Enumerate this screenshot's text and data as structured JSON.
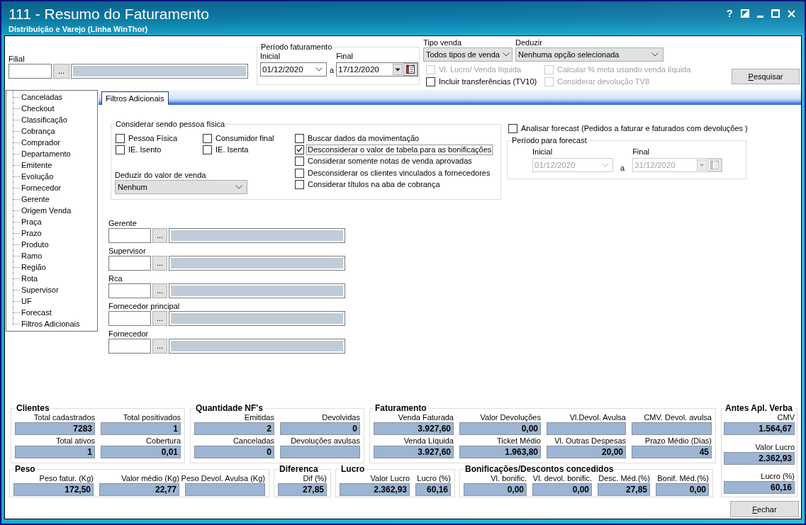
{
  "window": {
    "title": "111 - Resumo do Faturamento",
    "subtitle": "Distribuição e Varejo (Linha WinThor)",
    "help": "?"
  },
  "filial": {
    "label": "Filial",
    "button": "..."
  },
  "periodo_faturamento": {
    "title": "Período faturamento",
    "start": {
      "label": "Inicial",
      "value": "01/12/2020"
    },
    "separator": "a",
    "end": {
      "label": "Final",
      "value": "17/12/2020"
    }
  },
  "tipo_venda": {
    "label": "Tipo venda",
    "value": "Todos tipos de venda"
  },
  "deduzir": {
    "label": "Deduzir",
    "value": "Nenhuma opção selecionada"
  },
  "options": [
    {
      "label": "Vl. Lucro/ Venda líquida",
      "checked": false,
      "disabled": true
    },
    {
      "label": "Calcular % meta usando venda líquida",
      "checked": false,
      "disabled": true
    },
    {
      "label": "Incluir transferências (TV10)",
      "checked": false,
      "disabled": false
    },
    {
      "label": "Considerar devolução TV8",
      "checked": false,
      "disabled": true
    }
  ],
  "search_button": "Pesquisar",
  "tree": {
    "items": [
      "Canceladas",
      "Checkout",
      "Classificação",
      "Cobrança",
      "Comprador",
      "Departamento",
      "Emitente",
      "Evolução",
      "Fornecedor",
      "Gerente",
      "Origem Venda",
      "Praça",
      "Prazo",
      "Produto",
      "Ramo",
      "Região",
      "Rota",
      "Supervisor",
      "UF",
      "Forecast",
      "Filtros Adicionais"
    ]
  },
  "tabs": [
    {
      "label": "Filtros Adicionais",
      "selected": true
    }
  ],
  "pessoa_fisica": {
    "title": "Considerar sendo pessoa física",
    "options": [
      {
        "label": "Pessoa Física",
        "checked": false
      },
      {
        "label": "Consumidor final",
        "checked": false
      },
      {
        "label": "IE. Isento",
        "checked": false
      },
      {
        "label": "IE. Isenta",
        "checked": false
      }
    ],
    "deduct": {
      "label": "Deduzir do valor de venda",
      "value": "Nenhum"
    }
  },
  "filters": [
    {
      "label": "Buscar dados da movimentação",
      "checked": false,
      "focused": false
    },
    {
      "label": "Desconsiderar o valor de tabela para as bonificações",
      "checked": true,
      "focused": true
    },
    {
      "label": "Considerar somente notas de venda aprovadas",
      "checked": false,
      "focused": false
    },
    {
      "label": "Desconsiderar os clientes vinculados a fornecedores",
      "checked": false,
      "focused": false
    },
    {
      "label": "Considerar títulos na aba de cobrança",
      "checked": false,
      "focused": false
    }
  ],
  "forecast": {
    "label": "Analisar forecast (Pedidos a faturar e faturados com devoluções )",
    "checked": false,
    "period": {
      "title": "Período para forecast",
      "disabled": true,
      "start": {
        "label": "Inicial",
        "value": "01/12/2020"
      },
      "separator": "a",
      "end": {
        "label": "Final",
        "value": "31/12/2020"
      }
    }
  },
  "lookups": [
    {
      "label": "Gerente",
      "button": "..."
    },
    {
      "label": "Supervisor",
      "button": "..."
    },
    {
      "label": "Rca",
      "button": "..."
    },
    {
      "label": "Fornecedor principal",
      "button": "..."
    },
    {
      "label": "Fornecedor",
      "button": "..."
    }
  ],
  "summary": {
    "top": [
      {
        "title": "Clientes",
        "rows": [
          [
            {
              "label": "Total cadastrados",
              "value": "7283"
            },
            {
              "label": "Total positivados",
              "value": "1"
            }
          ],
          [
            {
              "label": "Total ativos",
              "value": "1"
            },
            {
              "label": "Cobertura",
              "value": "0,01"
            }
          ]
        ]
      },
      {
        "title": "Quantidade NF's",
        "rows": [
          [
            {
              "label": "Emitidas",
              "value": "2"
            },
            {
              "label": "Devolvidas",
              "value": "0"
            }
          ],
          [
            {
              "label": "Canceladas",
              "value": "0"
            },
            {
              "label": "Devoluções avulsas"
            }
          ]
        ]
      },
      {
        "title": "Faturamento",
        "rows": [
          [
            {
              "label": "Venda Faturada",
              "value": "3.927,60"
            },
            {
              "label": "Valor Devoluções",
              "value": "0,00"
            },
            {
              "label": "Vl.Devol. Avulsa"
            },
            {
              "label": "CMV. Devol. avulsa"
            }
          ],
          [
            {
              "label": "Venda Líquida",
              "value": "3.927,60"
            },
            {
              "label": "Ticket Médio",
              "value": "1.963,80"
            },
            {
              "label": "Vl. Outras Despesas",
              "value": "20,00"
            },
            {
              "label": "Prazo Médio (Dias)",
              "value": "45"
            }
          ]
        ]
      }
    ],
    "side": {
      "title": "Antes Apl. Verba",
      "rows": [
        [
          {
            "label": "CMV",
            "value": "1.564,67"
          }
        ],
        [
          {
            "label": "Valor Lucro",
            "value": "2.362,93"
          }
        ],
        [
          {
            "label": "Lucro (%)",
            "value": "60,16"
          }
        ]
      ]
    },
    "bottom": [
      {
        "title": "Peso",
        "rows": [
          [
            {
              "label": "Peso fatur. (Kg)",
              "value": "172,50"
            },
            {
              "label": "Valor médio (Kg)",
              "value": "22,77"
            },
            {
              "label": "Peso Devol. Avulsa (Kg)"
            }
          ]
        ]
      },
      {
        "title": "Diferenca",
        "rows": [
          [
            {
              "label": "Dif (%)",
              "value": "27,85"
            }
          ]
        ]
      },
      {
        "title": "Lucro",
        "rows": [
          [
            {
              "label": "Valor Lucro",
              "value": "2.362,93"
            },
            {
              "label": "Lucro (%)",
              "value": "60,16"
            }
          ]
        ]
      },
      {
        "title": "Bonificações/Descontos concedidos",
        "rows": [
          [
            {
              "label": "Vl. bonific.",
              "value": "0,00"
            },
            {
              "label": "Vl. devol. bonific.",
              "value": "0,00"
            },
            {
              "label": "Desc. Méd.(%)",
              "value": "27,85"
            },
            {
              "label": "Bonif. Méd.(%)",
              "value": "0,00"
            }
          ]
        ]
      }
    ]
  },
  "close_button": "Fechar"
}
